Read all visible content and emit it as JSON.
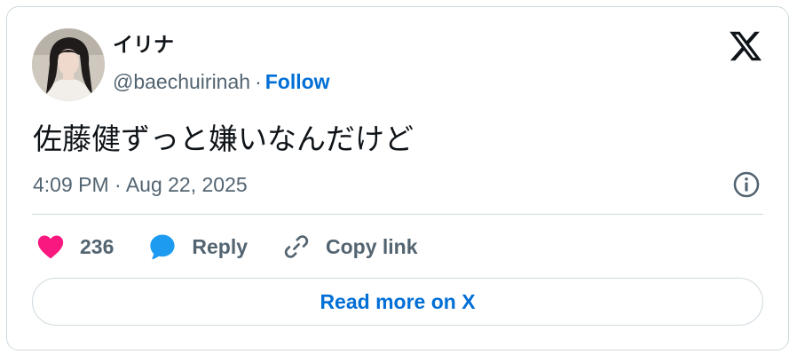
{
  "author": {
    "display_name": "イリナ",
    "handle": "@baechuirinah",
    "separator": "·",
    "follow_label": "Follow"
  },
  "tweet": {
    "text": "佐藤健ずっと嫌いなんだけど",
    "timestamp": "4:09 PM · Aug 22, 2025"
  },
  "actions": {
    "like_count": "236",
    "reply_label": "Reply",
    "copy_link_label": "Copy link"
  },
  "read_more_label": "Read more on X",
  "icons": {
    "brand": "x-logo-icon",
    "info": "info-icon",
    "like": "heart-icon",
    "reply": "speech-bubble-icon",
    "copy": "link-icon"
  },
  "colors": {
    "like": "#f91880",
    "reply": "#1d9bf0",
    "link": "#006fd6",
    "secondary_text": "#536471",
    "primary_text": "#0f1419",
    "border": "#cfd9de"
  }
}
